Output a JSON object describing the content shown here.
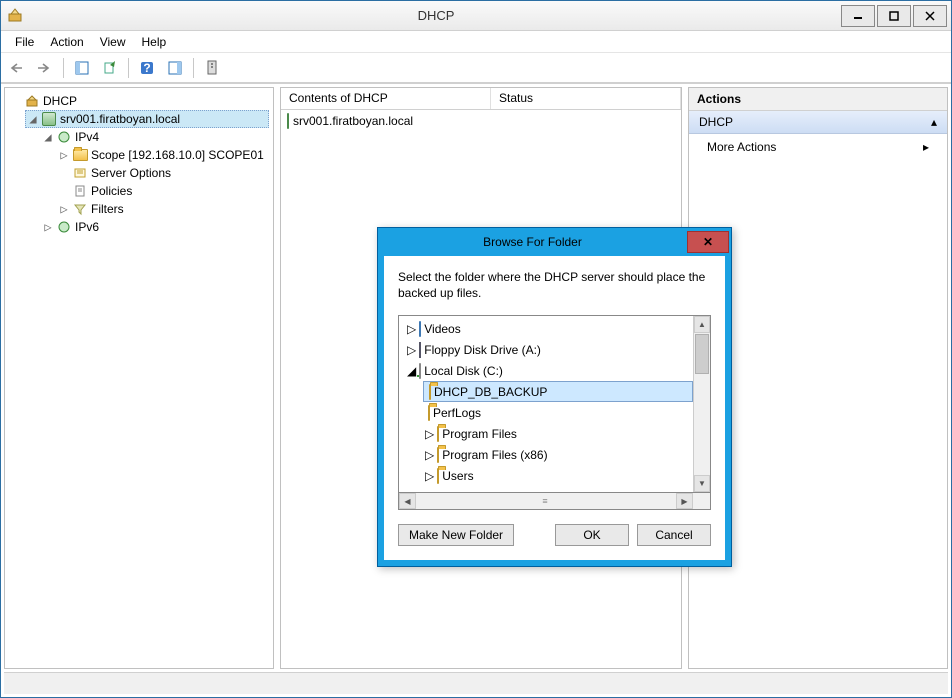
{
  "window": {
    "title": "DHCP"
  },
  "menus": {
    "file": "File",
    "action": "Action",
    "view": "View",
    "help": "Help"
  },
  "tree": {
    "root": "DHCP",
    "server": "srv001.firatboyan.local",
    "ipv4": "IPv4",
    "scope": "Scope [192.168.10.0] SCOPE01",
    "server_options": "Server Options",
    "policies": "Policies",
    "filters": "Filters",
    "ipv6": "IPv6"
  },
  "list": {
    "header_contents": "Contents of DHCP",
    "header_status": "Status",
    "row_server": "srv001.firatboyan.local"
  },
  "actions": {
    "header": "Actions",
    "section": "DHCP",
    "more": "More Actions"
  },
  "dialog": {
    "title": "Browse For Folder",
    "text": "Select the folder where the DHCP server should place the backed up files.",
    "items": {
      "videos": "Videos",
      "floppy": "Floppy Disk Drive (A:)",
      "localdisk": "Local Disk (C:)",
      "dhcp_backup": "DHCP_DB_BACKUP",
      "perflogs": "PerfLogs",
      "progfiles": "Program Files",
      "progfiles86": "Program Files (x86)",
      "users": "Users"
    },
    "buttons": {
      "make_new": "Make New Folder",
      "ok": "OK",
      "cancel": "Cancel"
    }
  }
}
